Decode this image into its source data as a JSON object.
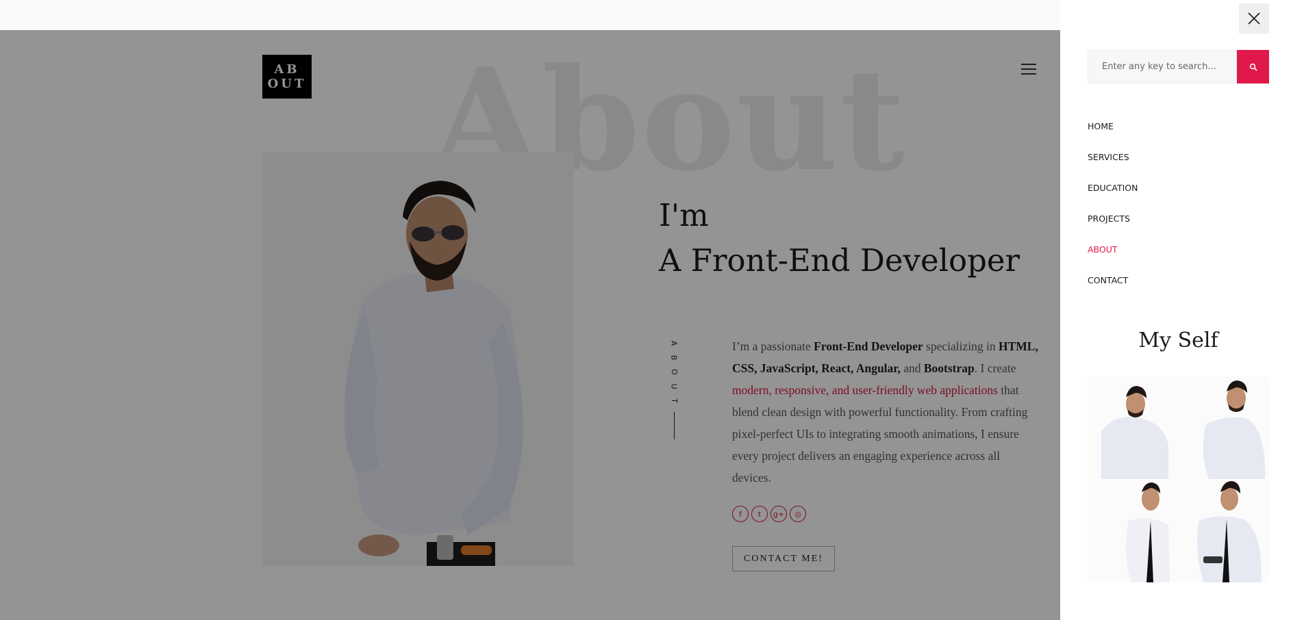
{
  "logo": {
    "line1": "AB",
    "line2": "OUT"
  },
  "hero": {
    "background_word": "About",
    "headline_line1": "I'm",
    "headline_line2": "A Front-End Developer",
    "vertical_label_letters": [
      "A",
      "B",
      "O",
      "U",
      "T"
    ]
  },
  "bio": {
    "p1": "I’m a passionate ",
    "b1": "Front-End Developer",
    "p2": " specializing in ",
    "b2": "HTML, CSS, JavaScript, React, Angular,",
    "p3": " and ",
    "b3": "Bootstrap",
    "p4": ". I create ",
    "accent": "modern, responsive, and user-friendly web applications",
    "p5": " that blend clean design with powerful functionality. From crafting pixel-perfect UIs to integrating smooth animations, I ensure every project delivers an engaging experience across all devices."
  },
  "socials": [
    {
      "icon": "facebook-icon",
      "glyph": "f"
    },
    {
      "icon": "twitter-icon",
      "glyph": "t"
    },
    {
      "icon": "google-plus-icon",
      "glyph": "g+"
    },
    {
      "icon": "dribbble-icon",
      "glyph": "◎"
    }
  ],
  "contact_button": "CONTACT ME!",
  "drawer": {
    "search_placeholder": "Enter any key to search...",
    "nav": [
      {
        "label": "HOME",
        "active": false
      },
      {
        "label": "SERVICES",
        "active": false
      },
      {
        "label": "EDUCATION",
        "active": false
      },
      {
        "label": "PROJECTS",
        "active": false
      },
      {
        "label": "ABOUT",
        "active": true
      },
      {
        "label": "CONTACT",
        "active": false
      }
    ],
    "gallery_title": "My Self"
  },
  "colors": {
    "accent": "#e0194a",
    "overlay": "rgba(0,0,0,0.42)"
  }
}
